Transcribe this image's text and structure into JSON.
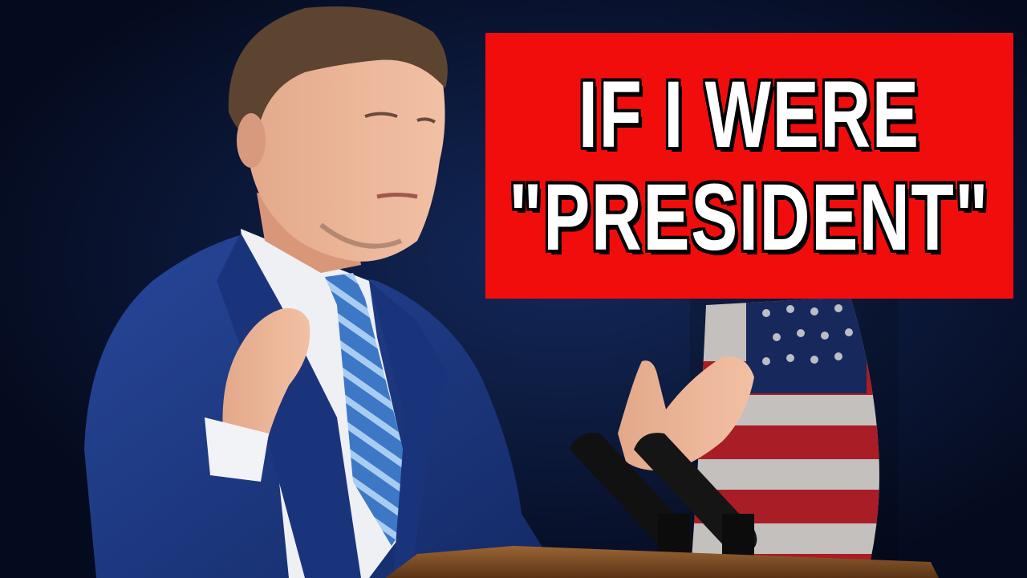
{
  "thumbnail": {
    "title_lines": [
      "IF I WERE",
      "\"PRESIDENT\""
    ],
    "colors": {
      "banner": "#f20d0d",
      "text": "#ffffff",
      "text_outline": "#000000",
      "background": "#081332",
      "suit": "#1f3a86",
      "tie": "#4a86d4",
      "podium": "#7a4a22"
    },
    "scene_elements": [
      "speaker-at-podium",
      "microphones",
      "american-flag",
      "dark-stage-background"
    ]
  }
}
